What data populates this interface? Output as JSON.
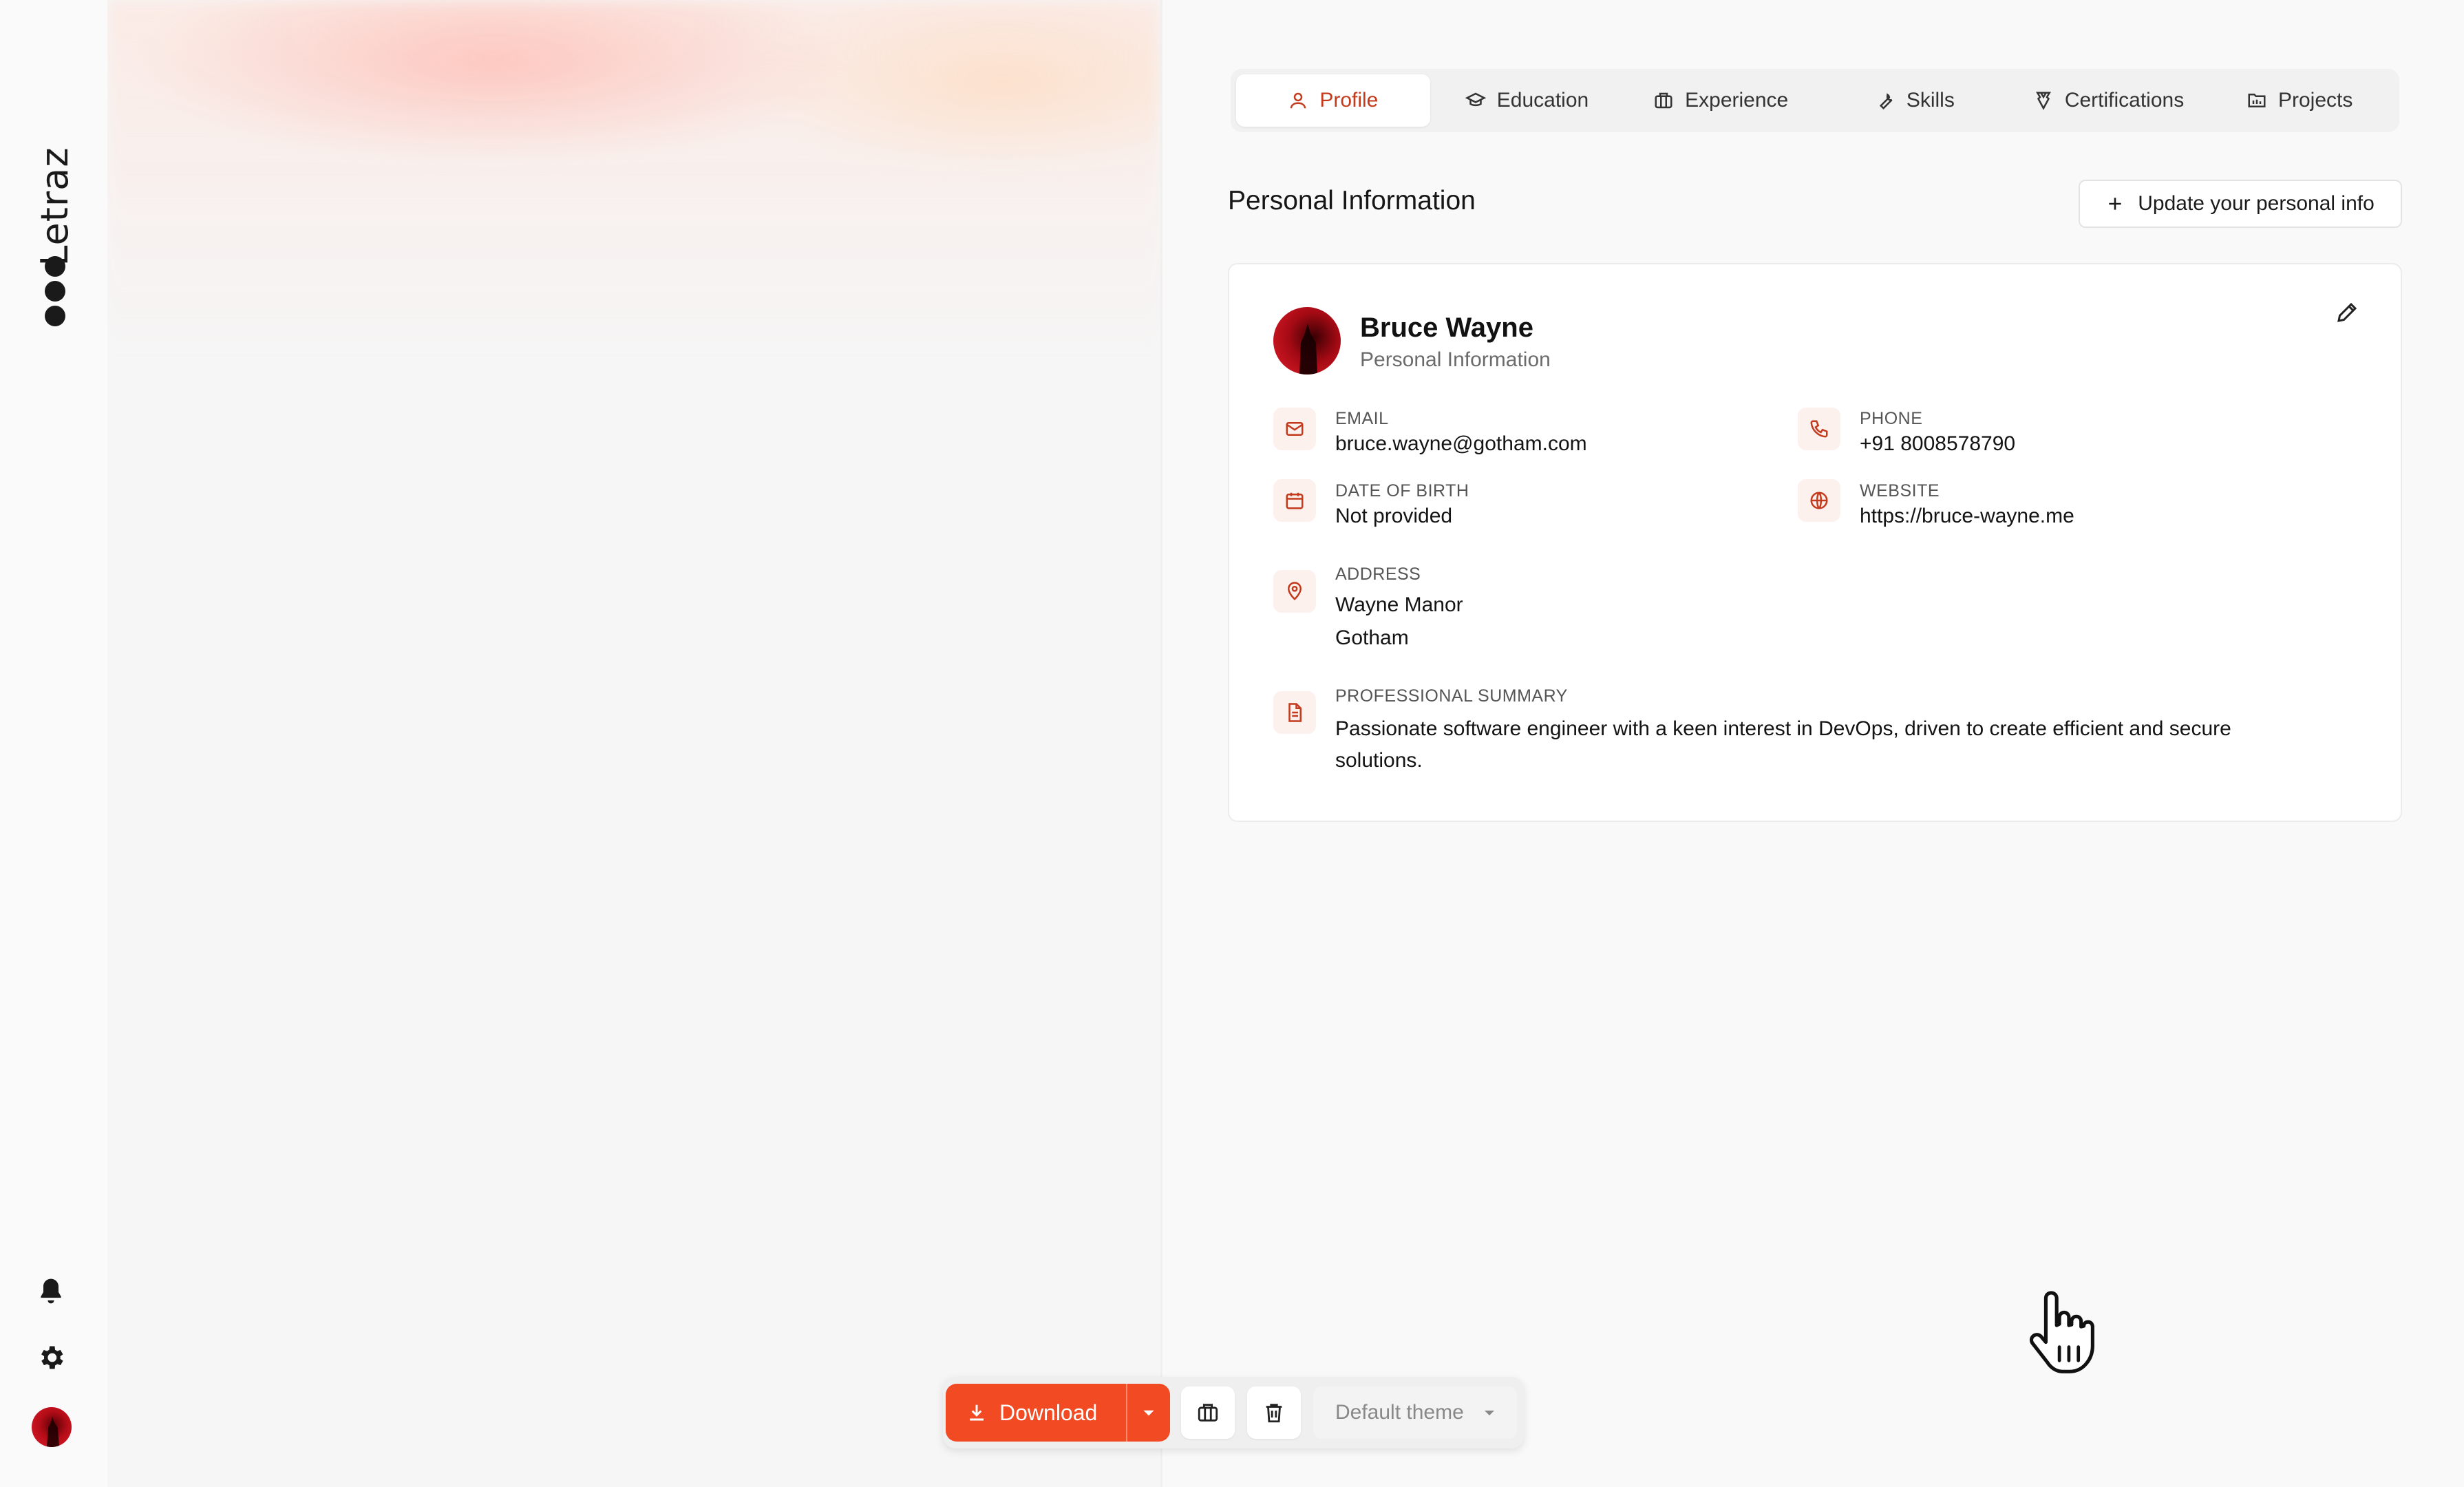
{
  "app": {
    "logo_text": "Letraz"
  },
  "tabs": [
    {
      "label": "Profile",
      "icon": "user-icon",
      "active": true
    },
    {
      "label": "Education",
      "icon": "graduation-cap-icon",
      "active": false
    },
    {
      "label": "Experience",
      "icon": "briefcase-icon",
      "active": false
    },
    {
      "label": "Skills",
      "icon": "wrench-icon",
      "active": false
    },
    {
      "label": "Certifications",
      "icon": "award-icon",
      "active": false
    },
    {
      "label": "Projects",
      "icon": "folder-icon",
      "active": false
    }
  ],
  "section": {
    "title": "Personal Information",
    "update_button": "Update your personal info"
  },
  "profile": {
    "name": "Bruce Wayne",
    "subtitle": "Personal Information",
    "email_label": "EMAIL",
    "email": "bruce.wayne@gotham.com",
    "phone_label": "PHONE",
    "phone": "+91 8008578790",
    "dob_label": "DATE OF BIRTH",
    "dob": "Not provided",
    "website_label": "WEBSITE",
    "website": "https://bruce-wayne.me",
    "address_label": "ADDRESS",
    "address_line1": "Wayne Manor",
    "address_line2": "Gotham",
    "summary_label": "PROFESSIONAL SUMMARY",
    "summary_line1": "Passionate software engineer with a keen interest in DevOps, driven to create efficient and secure",
    "summary_line2": "solutions."
  },
  "toolbar": {
    "download_label": "Download",
    "theme_value": "Default theme"
  },
  "colors": {
    "accent": "#f24a23",
    "accent_text": "#c33a1c",
    "icon_bg": "#fdf1ee"
  }
}
